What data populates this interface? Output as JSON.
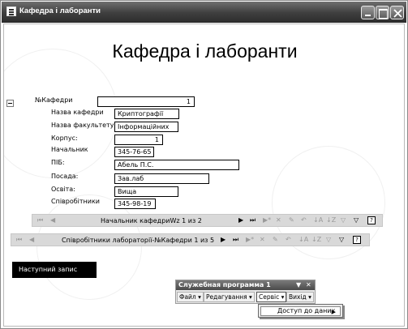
{
  "window": {
    "title": "Кафедра і лаборанти"
  },
  "form": {
    "heading": "Кафедра і лаборанти",
    "fields": [
      {
        "id": "dept_no",
        "label": "№Кафедри",
        "value": "1"
      },
      {
        "id": "dept_name",
        "label": "Назва кафедри",
        "value": "Криптографії"
      },
      {
        "id": "faculty_name",
        "label": "Назва факультету",
        "value": "Інформаційних"
      },
      {
        "id": "building",
        "label": "Корпус:",
        "value": "1"
      },
      {
        "id": "head",
        "label": "Начальник",
        "value": "345-76-65"
      },
      {
        "id": "full_name",
        "label": "ПІБ:",
        "value": "Абель П.С."
      },
      {
        "id": "position",
        "label": "Посада:",
        "value": "Зав.лаб"
      },
      {
        "id": "education",
        "label": "Освіта:",
        "value": "Вища"
      },
      {
        "id": "staff",
        "label": "Співробітники",
        "value": "345-98-19"
      }
    ]
  },
  "subform_nav": {
    "text": "Начальник кафедриWz 1 из 2"
  },
  "main_nav": {
    "text": "Співробітники лабораторії-№Кафедри 1 из 5"
  },
  "buttons": {
    "next_record": "Наступний запис"
  },
  "toolbox": {
    "title": "Служебная программа 1",
    "menus": [
      "Файл ▾",
      "Редагування ▾",
      "Сервіс ▾",
      "Вихід ▾"
    ]
  },
  "dropdown": {
    "item": "Доступ до даних"
  },
  "icons": {
    "first": "first-record-icon",
    "prev": "prev-record-icon",
    "next": "next-record-icon",
    "last": "last-record-icon",
    "new": "new-record-icon",
    "delete": "delete-record-icon",
    "save": "save-icon",
    "undo": "undo-icon",
    "sort_asc": "sort-ascending-icon",
    "sort_desc": "sort-descending-icon",
    "filter_edit": "filter-edit-icon",
    "filter": "filter-icon",
    "help": "help-icon"
  }
}
